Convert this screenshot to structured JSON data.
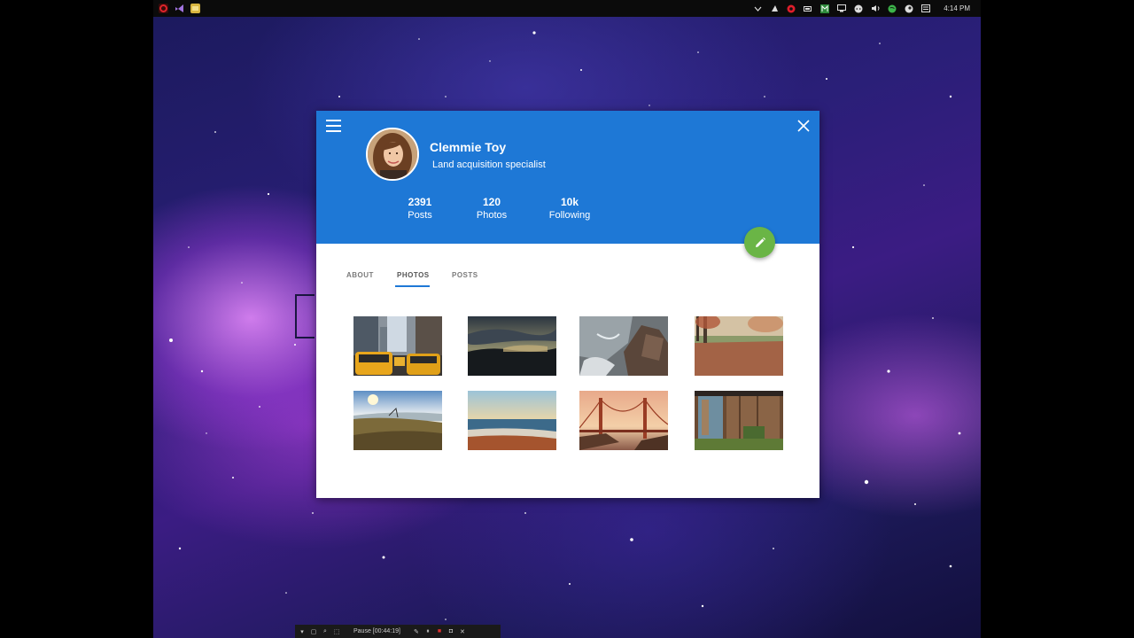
{
  "taskbar": {
    "apps": [
      "opera-app-icon",
      "visual-studio-app-icon",
      "explorer-app-icon"
    ],
    "tray_icons": [
      "chevron-up-icon",
      "app-tray-icon",
      "beats-icon",
      "battery-icon",
      "green-app-icon",
      "network-icon",
      "chat-icon",
      "volume-icon",
      "spotify-icon",
      "steam-icon",
      "notifications-icon"
    ],
    "clock": "4:14 PM"
  },
  "profile": {
    "name": "Clemmie Toy",
    "role": "Land acquisition specialist",
    "stats": [
      {
        "value": "2391",
        "label": "Posts"
      },
      {
        "value": "120",
        "label": "Photos"
      },
      {
        "value": "10k",
        "label": "Following"
      }
    ]
  },
  "tabs": [
    {
      "label": "ABOUT",
      "active": false
    },
    {
      "label": "PHOTOS",
      "active": true
    },
    {
      "label": "POSTS",
      "active": false
    }
  ],
  "photos": [
    "city-taxis-photo",
    "sunset-lake-photo",
    "ocean-rocks-photo",
    "autumn-park-photo",
    "grassland-coast-photo",
    "beach-sunset-photo",
    "golden-gate-bridge-photo",
    "wooden-shed-photo"
  ],
  "recorder": {
    "status": "Pause [00:44:19]"
  },
  "colors": {
    "header": "#1e78d6",
    "fab": "#6ab546",
    "tab_indicator": "#1e78d6"
  }
}
